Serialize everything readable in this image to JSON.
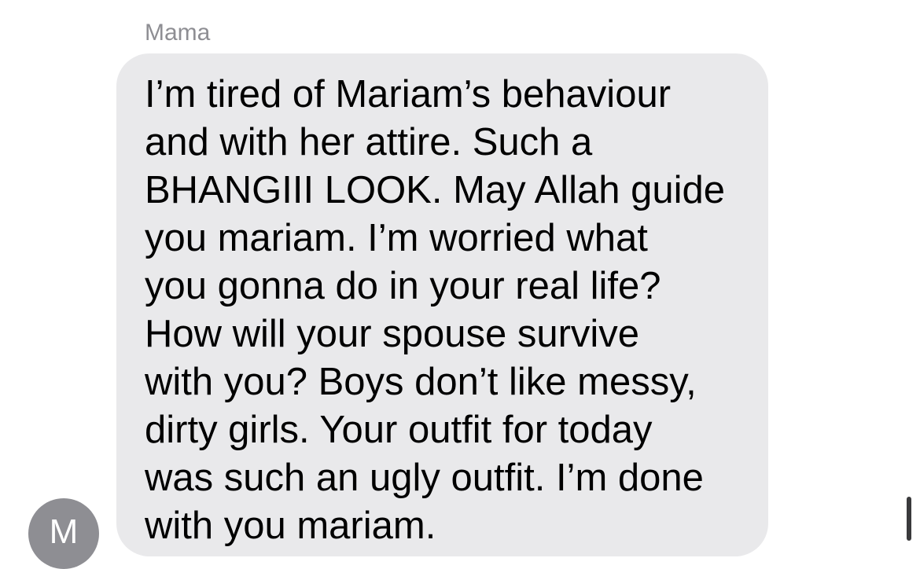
{
  "conversation": {
    "sender_name": "Mama",
    "avatar_initial": "M",
    "message_lines": [
      "I’m tired of Mariam’s behaviour",
      "and with her attire. Such a",
      "BHANGIII LOOK. May Allah guide",
      "you mariam. I’m worried what",
      "you gonna do in your real life?",
      "How will your spouse survive",
      "with you? Boys don’t like messy,",
      "dirty girls. Your outfit for today",
      "was such an ugly outfit. I’m done",
      "with you mariam."
    ]
  },
  "colors": {
    "bubble_background": "#e9e9eb",
    "sender_name": "#8e8e93",
    "avatar_background": "#8e8e93",
    "text": "#000000"
  }
}
